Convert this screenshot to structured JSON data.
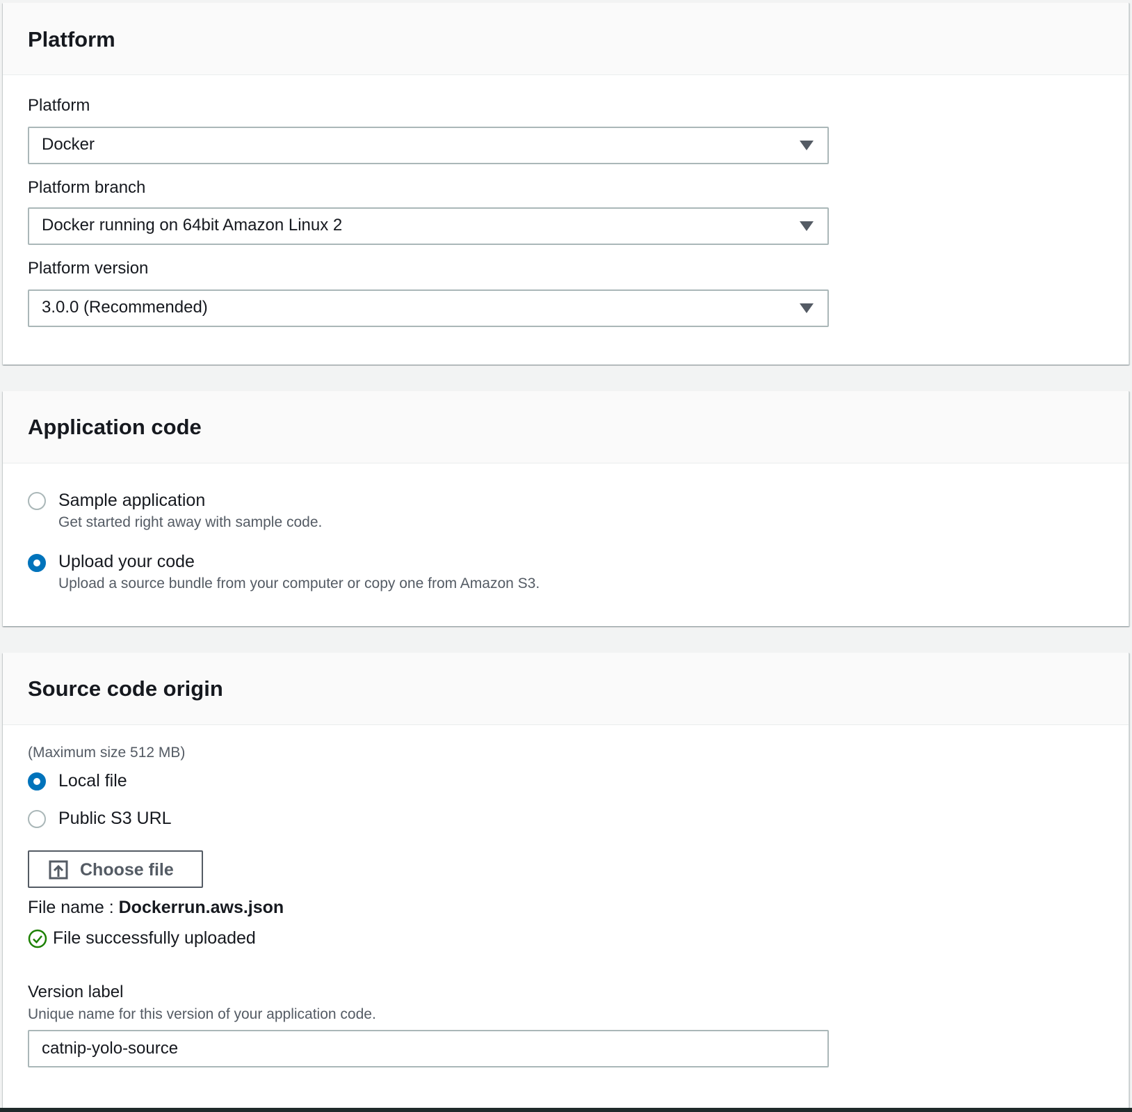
{
  "platform_section": {
    "title": "Platform",
    "platform": {
      "label": "Platform",
      "value": "Docker"
    },
    "platform_branch": {
      "label": "Platform branch",
      "value": "Docker running on 64bit Amazon Linux 2"
    },
    "platform_version": {
      "label": "Platform version",
      "value": "3.0.0 (Recommended)"
    }
  },
  "application_code_section": {
    "title": "Application code",
    "options": [
      {
        "label": "Sample application",
        "description": "Get started right away with sample code.",
        "selected": false
      },
      {
        "label": "Upload your code",
        "description": "Upload a source bundle from your computer or copy one from Amazon S3.",
        "selected": true
      }
    ]
  },
  "source_code_origin_section": {
    "title": "Source code origin",
    "max_size_note": "(Maximum size 512 MB)",
    "options": [
      {
        "label": "Local file",
        "selected": true
      },
      {
        "label": "Public S3 URL",
        "selected": false
      }
    ],
    "choose_file_label": "Choose file",
    "file_name_prefix": "File name :",
    "file_name": "Dockerrun.aws.json",
    "upload_status": "File successfully uploaded",
    "version_label": {
      "label": "Version label",
      "description": "Unique name for this version of your application code.",
      "value": "catnip-yolo-source"
    }
  },
  "colors": {
    "accent": "#0073bb",
    "success": "#1d8102",
    "border": "#aab7b8",
    "secondary_text": "#545b64"
  }
}
